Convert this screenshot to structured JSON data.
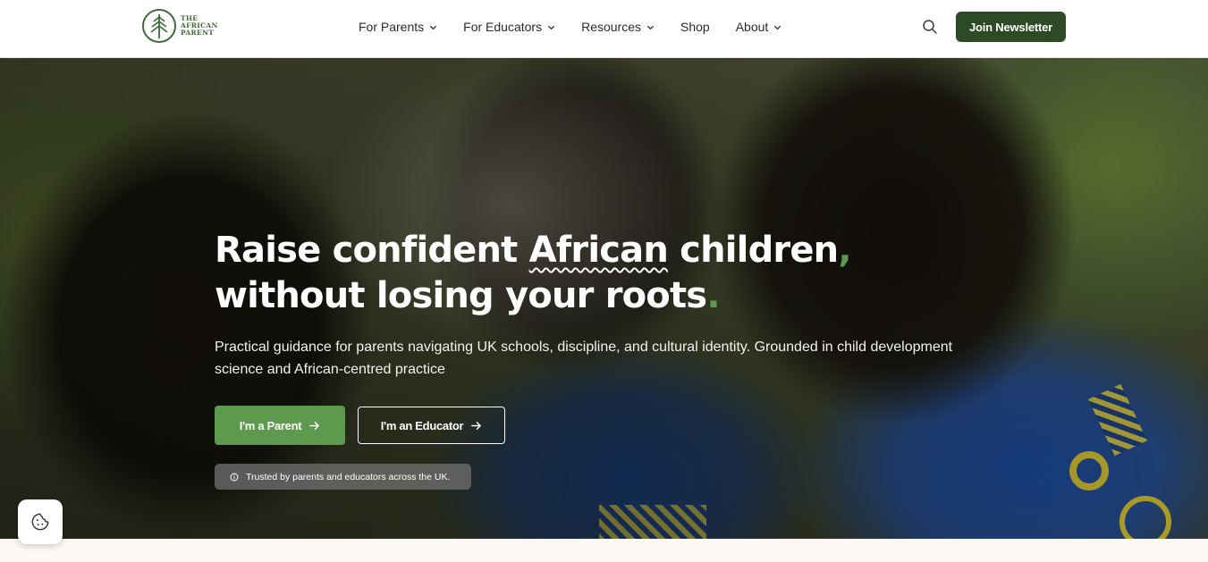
{
  "brand": {
    "logo_lines": [
      "THE",
      "AFRICAN",
      "PARENT"
    ],
    "logo_icon": "tree-in-circle-icon",
    "color": "#3f6b3b"
  },
  "nav": {
    "items": [
      {
        "label": "For Parents",
        "has_dropdown": true
      },
      {
        "label": "For Educators",
        "has_dropdown": true
      },
      {
        "label": "Resources",
        "has_dropdown": true
      },
      {
        "label": "Shop",
        "has_dropdown": false
      },
      {
        "label": "About",
        "has_dropdown": true
      }
    ],
    "search_icon": "search-icon",
    "cta_label": "Join Newsletter",
    "cta_color": "#2c4a26"
  },
  "hero": {
    "headline_part1": "Raise confident ",
    "headline_emphasis": "African",
    "headline_part2": " children",
    "headline_comma": ",",
    "headline_line2": "without losing your roots",
    "headline_period": ".",
    "subtitle": "Practical guidance for parents navigating UK schools, discipline, and cultural identity. Grounded in child development science and African-centred practice",
    "primary_button": "I'm a Parent",
    "secondary_button": "I'm an Educator",
    "trust_text": "Trusted by parents and educators across the UK.",
    "accent_color": "#5d9a4e"
  },
  "cookie": {
    "icon": "cookie-icon"
  }
}
